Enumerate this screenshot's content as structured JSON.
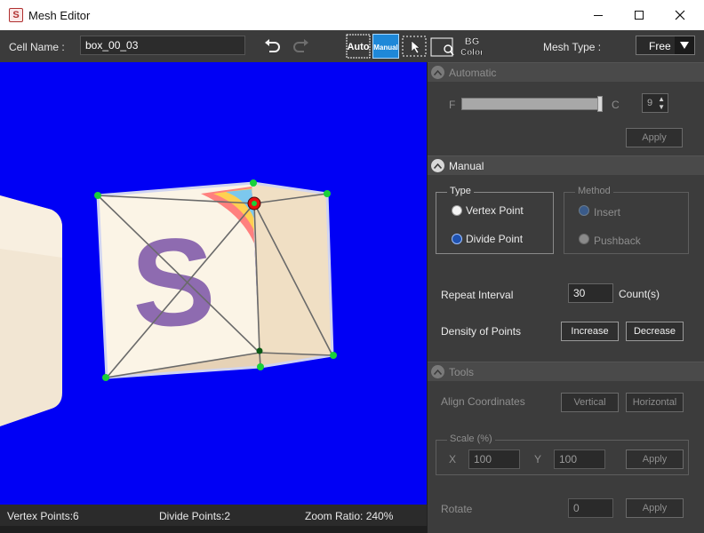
{
  "window": {
    "title": "Mesh Editor",
    "app_icon": "S"
  },
  "toolbar": {
    "cell_name_label": "Cell Name :",
    "cell_name_value": "box_00_03",
    "auto_label_1": "Auto",
    "manual_label_1": "Manual",
    "bg_label_1": "BG",
    "bg_label_2": "Color",
    "mesh_type_label": "Mesh Type :",
    "mesh_type_value": "Free"
  },
  "canvas": {
    "glyph": "S",
    "background": "#0000f5"
  },
  "status": {
    "vertex_points": "Vertex Points:6",
    "divide_points": "Divide Points:2",
    "zoom_ratio": "Zoom Ratio: 240%"
  },
  "automatic": {
    "title": "Automatic",
    "f_label": "F",
    "c_label": "C",
    "spin_value": "9",
    "apply_label": "Apply"
  },
  "manual": {
    "title": "Manual",
    "type_group": "Type",
    "vertex_point": "Vertex Point",
    "divide_point": "Divide Point",
    "method_group": "Method",
    "insert": "Insert",
    "pushback": "Pushback",
    "repeat_interval_label": "Repeat Interval",
    "repeat_interval_value": "30",
    "count_label": "Count(s)",
    "density_label": "Density of Points",
    "increase_label": "Increase",
    "decrease_label": "Decrease"
  },
  "tools": {
    "title": "Tools",
    "align_label": "Align Coordinates",
    "vertical_label": "Vertical",
    "horizontal_label": "Horizontal",
    "scale_group": "Scale (%)",
    "x_label": "X",
    "x_value": "100",
    "y_label": "Y",
    "y_value": "100",
    "scale_apply": "Apply",
    "rotate_label": "Rotate",
    "rotate_value": "0",
    "rotate_apply": "Apply"
  },
  "colors": {
    "accent": "#1e88d8",
    "canvas": "#0000f5",
    "vertex": "#19d13a",
    "selected_vertex": "#e81010"
  }
}
